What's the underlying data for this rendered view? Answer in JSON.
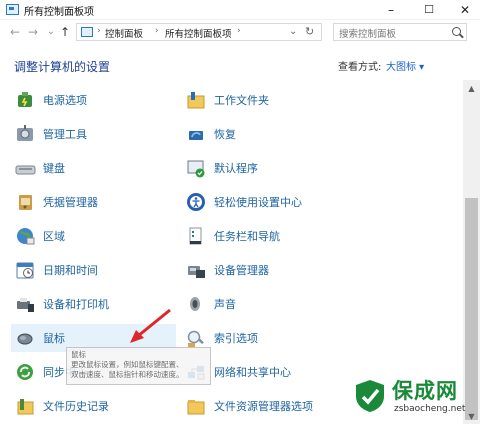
{
  "window": {
    "title": "所有控制面板项",
    "minimize": "–",
    "maximize": "☐",
    "close": "✕"
  },
  "address": {
    "back": "←",
    "forward": "→",
    "recent": "⌄",
    "up": "↑",
    "crumbs": [
      "控制面板",
      "所有控制面板项"
    ],
    "separator": "›",
    "dropdown": "⌄",
    "refresh": "↻",
    "search_placeholder": "搜索控制面板"
  },
  "header": {
    "title": "调整计算机的设置",
    "view_by_label": "查看方式:",
    "view_by_value": "大图标 ▾"
  },
  "items_left": [
    {
      "label": "电源选项",
      "icon": "power-options-icon"
    },
    {
      "label": "管理工具",
      "icon": "admin-tools-icon"
    },
    {
      "label": "键盘",
      "icon": "keyboard-icon"
    },
    {
      "label": "凭据管理器",
      "icon": "credential-manager-icon"
    },
    {
      "label": "区域",
      "icon": "region-icon"
    },
    {
      "label": "日期和时间",
      "icon": "date-time-icon"
    },
    {
      "label": "设备和打印机",
      "icon": "devices-printers-icon"
    },
    {
      "label": "鼠标",
      "icon": "mouse-icon"
    },
    {
      "label": "同步中心",
      "icon": "sync-center-icon"
    },
    {
      "label": "文件历史记录",
      "icon": "file-history-icon"
    }
  ],
  "items_right": [
    {
      "label": "工作文件夹",
      "icon": "work-folders-icon"
    },
    {
      "label": "恢复",
      "icon": "recovery-icon"
    },
    {
      "label": "默认程序",
      "icon": "default-programs-icon"
    },
    {
      "label": "轻松使用设置中心",
      "icon": "ease-of-access-icon"
    },
    {
      "label": "任务栏和导航",
      "icon": "taskbar-navigation-icon"
    },
    {
      "label": "设备管理器",
      "icon": "device-manager-icon"
    },
    {
      "label": "声音",
      "icon": "sound-icon"
    },
    {
      "label": "索引选项",
      "icon": "indexing-options-icon"
    },
    {
      "label": "网络和共享中心",
      "icon": "network-sharing-icon"
    },
    {
      "label": "文件资源管理器选项",
      "icon": "file-explorer-options-icon"
    }
  ],
  "tooltip": {
    "title": "鼠标",
    "line1": "更改鼠标设置，例如鼠标键配置、",
    "line2": "双击速度、鼠标指针和移动速度。"
  },
  "watermark": {
    "brand": "保成网",
    "url": "zsbaocheng.net"
  },
  "scrollbar": {
    "up": "▲",
    "down": "▼"
  },
  "colors": {
    "link": "#1e64a0",
    "heading": "#1e3f91",
    "accent": "#1e64c8",
    "annotation_arrow": "#e0262a",
    "watermark_green": "#1a8a3a"
  }
}
